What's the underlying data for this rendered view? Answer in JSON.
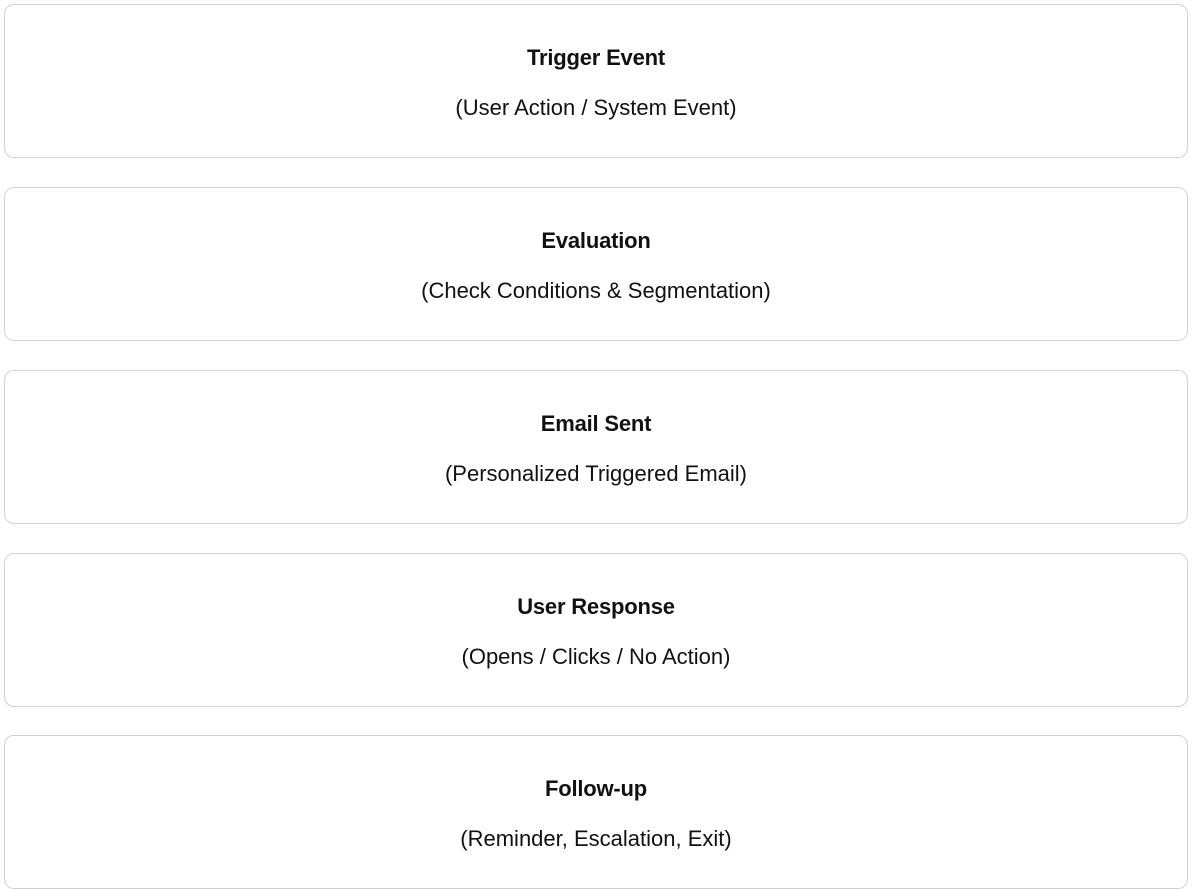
{
  "steps": [
    {
      "title": "Trigger Event",
      "subtitle": "(User Action / System Event)"
    },
    {
      "title": "Evaluation",
      "subtitle": "(Check Conditions & Segmentation)"
    },
    {
      "title": "Email Sent",
      "subtitle": "(Personalized Triggered Email)"
    },
    {
      "title": "User Response",
      "subtitle": "(Opens / Clicks / No Action)"
    },
    {
      "title": "Follow-up",
      "subtitle": "(Reminder, Escalation, Exit)"
    }
  ]
}
